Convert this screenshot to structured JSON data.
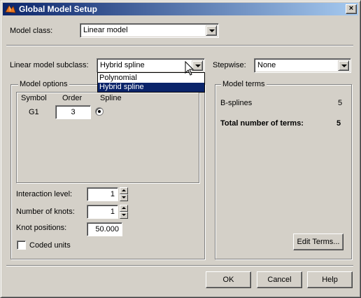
{
  "window": {
    "title": "Global Model Setup",
    "close_glyph": "×",
    "icon": "matlab-membrane-icon"
  },
  "model_class": {
    "label": "Model class:",
    "value": "Linear model"
  },
  "subclass": {
    "label": "Linear model subclass:",
    "value": "Hybrid spline",
    "options": [
      "Polynomial",
      "Hybrid spline"
    ],
    "highlighted": "Hybrid spline"
  },
  "stepwise": {
    "label": "Stepwise:",
    "value": "None"
  },
  "model_options": {
    "title": "Model options",
    "columns": [
      "Symbol",
      "Order",
      "Spline"
    ],
    "row": {
      "symbol": "G1",
      "order": "3",
      "spline_selected": true
    }
  },
  "interaction_level": {
    "label": "Interaction level:",
    "value": "1"
  },
  "num_knots": {
    "label": "Number of knots:",
    "value": "1"
  },
  "knot_positions": {
    "label": "Knot positions:",
    "value": "50.000"
  },
  "coded_units": {
    "label": "Coded units",
    "checked": false
  },
  "model_terms": {
    "title": "Model terms",
    "bsplines_label": "B-splines",
    "bsplines_value": "5",
    "total_label": "Total number of terms:",
    "total_value": "5",
    "edit_button": "Edit Terms..."
  },
  "buttons": {
    "ok": "OK",
    "cancel": "Cancel",
    "help": "Help"
  },
  "colors": {
    "face": "#d4d0c8",
    "title_start": "#0a246a",
    "title_end": "#a6caf0",
    "selection": "#0a246a"
  }
}
